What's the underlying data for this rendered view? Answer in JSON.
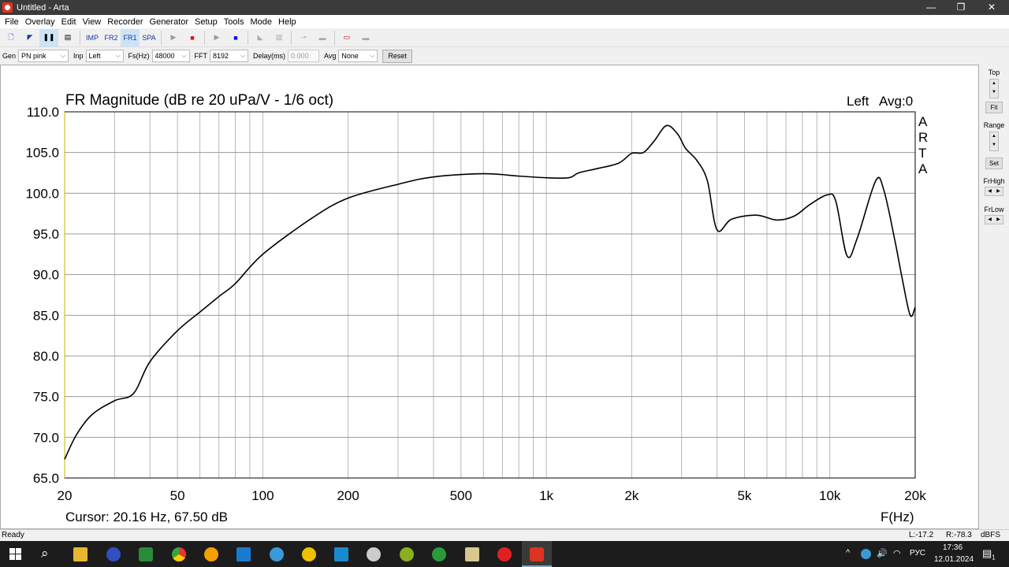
{
  "window": {
    "title": "Untitled - Arta",
    "min": "—",
    "max": "❐",
    "close": "✕"
  },
  "menu": [
    "File",
    "Overlay",
    "Edit",
    "View",
    "Recorder",
    "Generator",
    "Setup",
    "Tools",
    "Mode",
    "Help"
  ],
  "toolbar": {
    "imp": "IMP",
    "fr2": "FR2",
    "fr1": "FR1",
    "spa": "SPA"
  },
  "params": {
    "gen_label": "Gen",
    "gen": "PN pink",
    "inp_label": "Inp",
    "inp": "Left",
    "fs_label": "Fs(Hz)",
    "fs": "48000",
    "fft_label": "FFT",
    "fft": "8192",
    "delay_label": "Delay(ms)",
    "delay": "0.000",
    "avg_label": "Avg",
    "avg": "None",
    "reset": "Reset"
  },
  "side": {
    "top": "Top",
    "fit": "Fit",
    "range": "Range",
    "set": "Set",
    "frhigh": "FrHigh",
    "frlow": "FrLow"
  },
  "status": {
    "ready": "Ready",
    "l": "L:-17.2",
    "r": "R:-78.3",
    "unit": "dBFS"
  },
  "taskbar": {
    "lang": "РУС",
    "time": "17:36",
    "date": "12.01.2024",
    "notif": "1"
  },
  "chart_data": {
    "type": "line",
    "title": "FR Magnitude (dB re 20 uPa/V - 1/6 oct)",
    "channel": "Left",
    "avg": "Avg:0",
    "watermark": "ARTA",
    "xlabel": "F(Hz)",
    "xscale": "log",
    "xlim": [
      20,
      20000
    ],
    "ylim": [
      65,
      110
    ],
    "xticks": [
      {
        "v": 20,
        "l": "20"
      },
      {
        "v": 50,
        "l": "50"
      },
      {
        "v": 100,
        "l": "100"
      },
      {
        "v": 200,
        "l": "200"
      },
      {
        "v": 500,
        "l": "500"
      },
      {
        "v": 1000,
        "l": "1k"
      },
      {
        "v": 2000,
        "l": "2k"
      },
      {
        "v": 5000,
        "l": "5k"
      },
      {
        "v": 10000,
        "l": "10k"
      },
      {
        "v": 20000,
        "l": "20k"
      }
    ],
    "yticks": [
      "110.0",
      "105.0",
      "100.0",
      "95.0",
      "90.0",
      "85.0",
      "80.0",
      "75.0",
      "70.0",
      "65.0"
    ],
    "cursor": "Cursor: 20.16 Hz, 67.50 dB",
    "series": [
      {
        "name": "Left",
        "color": "#000000",
        "x": [
          20,
          22,
          25,
          30,
          35,
          40,
          50,
          60,
          70,
          80,
          100,
          150,
          200,
          300,
          400,
          600,
          800,
          1000,
          1200,
          1300,
          1500,
          1800,
          2000,
          2200,
          2400,
          2650,
          2900,
          3100,
          3400,
          3700,
          4000,
          4500,
          5500,
          6500,
          7500,
          8500,
          9800,
          10500,
          11500,
          12500,
          14500,
          15500,
          17000,
          18000,
          19200,
          20000
        ],
        "y": [
          67.3,
          70.3,
          72.8,
          74.5,
          75.4,
          79.3,
          83.1,
          85.4,
          87.3,
          88.9,
          92.5,
          97.0,
          99.4,
          101.1,
          102.0,
          102.4,
          102.1,
          101.9,
          101.9,
          102.5,
          103.0,
          103.7,
          104.9,
          105.0,
          106.4,
          108.3,
          107.3,
          105.5,
          104.0,
          101.5,
          95.5,
          96.8,
          97.3,
          96.7,
          97.2,
          98.6,
          99.8,
          99.0,
          92.3,
          94.5,
          101.5,
          100.4,
          94.0,
          89.5,
          85.0,
          86.0
        ]
      }
    ]
  }
}
